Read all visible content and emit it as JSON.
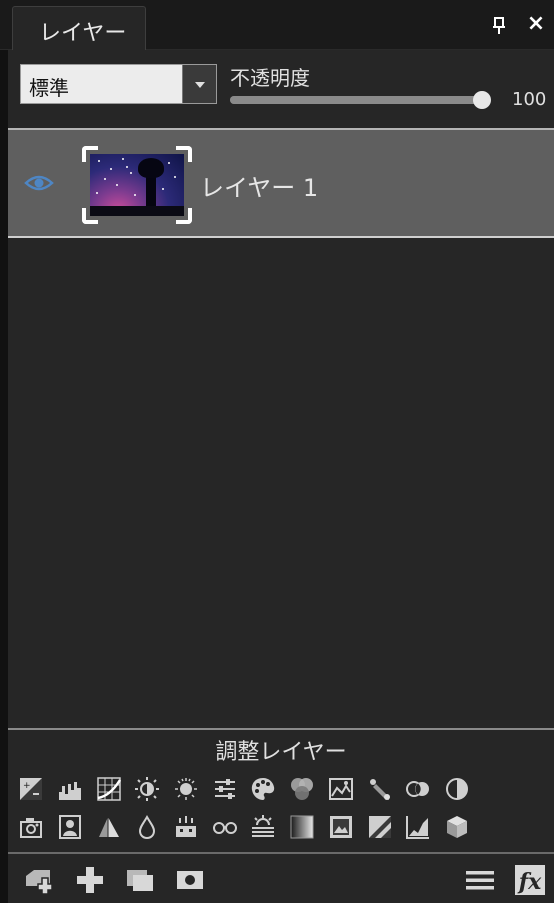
{
  "panel": {
    "tab_label": "レイヤー",
    "pin_icon": "pin-icon",
    "close_label": "×"
  },
  "blend": {
    "mode": "標準"
  },
  "opacity": {
    "label": "不透明度",
    "value": "100",
    "percent": 100
  },
  "layers": [
    {
      "name": "レイヤー 1",
      "visible": true,
      "selected": true
    }
  ],
  "adjustments": {
    "title": "調整レイヤー",
    "row1": [
      "exposure-icon",
      "levels-icon",
      "curves-icon",
      "brightness-icon",
      "shadows-highlights-icon",
      "color-balance-icon",
      "palette-icon",
      "rgb-mix-icon",
      "landscape-icon",
      "tone-pipette-icon",
      "channel-mixer-icon",
      "invert-icon"
    ],
    "row2": [
      "camera-icon",
      "portrait-icon",
      "posterize-icon",
      "droplet-icon",
      "vibrance-icon",
      "glasses-icon",
      "haze-icon",
      "gradient-map-icon",
      "photo-filter-icon",
      "threshold-icon",
      "histogram-icon",
      "lut-cube-icon"
    ]
  },
  "toolbar": {
    "left": [
      "new-layer-from-icon",
      "add-layer-icon",
      "duplicate-layer-icon",
      "add-mask-icon"
    ],
    "right": [
      "menu-icon",
      "fx-icon"
    ]
  },
  "colors": {
    "panel_bg": "#262626",
    "selected_row": "#5f5f5f",
    "eye_accent": "#4e86c4"
  }
}
